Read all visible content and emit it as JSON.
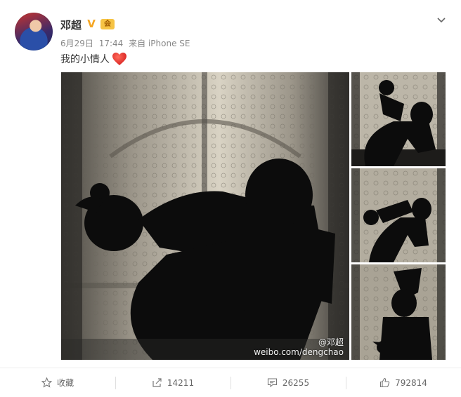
{
  "user": {
    "name": "邓超",
    "verified_mark": "V",
    "member_badge": "会"
  },
  "post": {
    "date": "6月29日",
    "time": "17:44",
    "source": "来自 iPhone SE",
    "text": "我的小情人",
    "emoji": "heart-icon"
  },
  "images": {
    "watermark_handle": "@邓超",
    "watermark_url": "weibo.com/dengchao",
    "count": 4
  },
  "actions": {
    "favorite_label": "收藏",
    "repost_count": "14211",
    "comment_count": "26255",
    "like_count": "792814"
  },
  "colors": {
    "accent": "#f5a623",
    "heart": "#e8332b",
    "text": "#333333",
    "meta": "#888888"
  }
}
